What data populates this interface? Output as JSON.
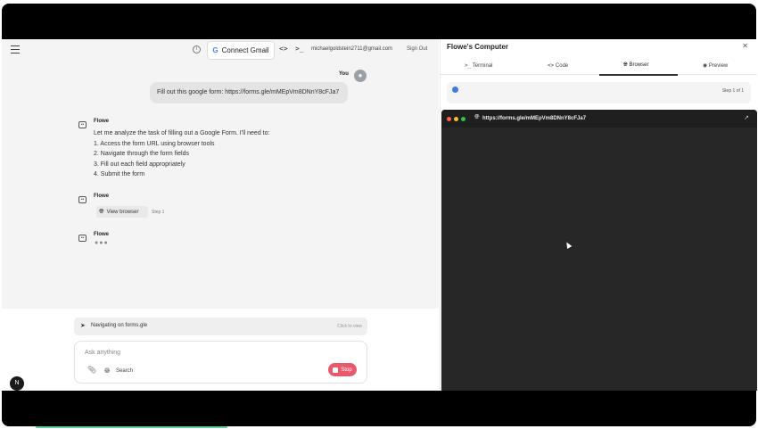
{
  "header": {
    "connect_gmail_label": "Connect Gmail",
    "email": "michaelgoldstein2711@gmail.com",
    "sign_out_label": "Sign Out"
  },
  "conversation": {
    "user": {
      "name": "You",
      "message": "Fill out this google form: https://forms.gle/mMEpVm8DNnY8cFJa7"
    },
    "assistant_1": {
      "name": "Flowe",
      "lines": [
        "Let me analyze the task of filling out a Google Form. I'll need to:",
        "1. Access the form URL using browser tools",
        "2. Navigate through the form fields",
        "3. Fill out each field appropriately",
        "4. Submit the form"
      ]
    },
    "assistant_2": {
      "name": "Flowe",
      "view_browser_label": "View browser",
      "step_label": "Step 1"
    },
    "assistant_3": {
      "name": "Flowe",
      "typing": "●●●"
    }
  },
  "status_bar": {
    "text": "Navigating on forms.gle",
    "click_hint": "Click to view"
  },
  "composer": {
    "placeholder": "Ask anything",
    "search_label": "Search",
    "stop_label": "Stop"
  },
  "badge": {
    "letter": "N"
  },
  "computer_panel": {
    "title": "Flowe's Computer",
    "tabs": [
      {
        "label": "Terminal",
        "icon": "terminal-icon",
        "active": false
      },
      {
        "label": "Code",
        "icon": "code-icon",
        "active": false
      },
      {
        "label": "Browser",
        "icon": "globe-icon",
        "active": true
      },
      {
        "label": "Preview",
        "icon": "play-circle-icon",
        "active": false
      }
    ],
    "step_indicator": "Step 1 of 1",
    "browser": {
      "url": "https://forms.gle/mMEpVm8DNnY8cFJa7"
    }
  },
  "colors": {
    "stop_button": "#e8596d",
    "step_dot": "#3b7de0",
    "browser_bg": "#272727",
    "traffic_red": "#ff5f57",
    "traffic_yellow": "#febc2e",
    "traffic_green": "#28c840"
  }
}
